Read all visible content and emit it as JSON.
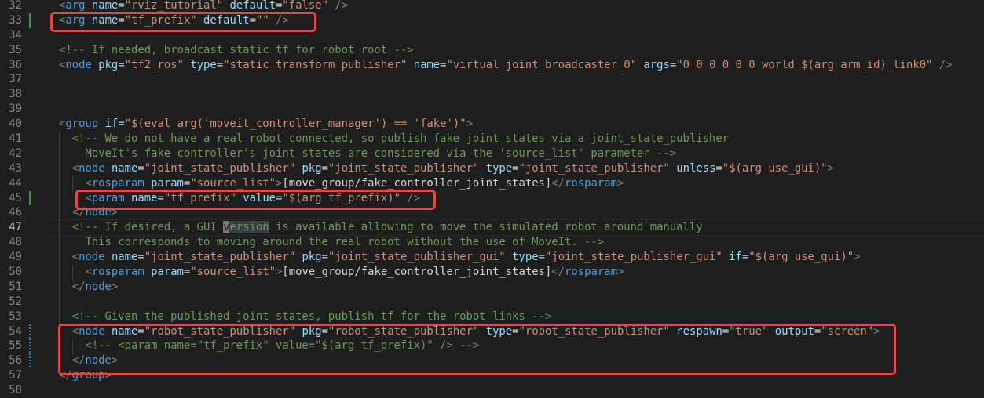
{
  "editor": {
    "colors": {
      "background": "#1e1e1e",
      "tag": "#569cd6",
      "attribute": "#9cdcfe",
      "string": "#ce9178",
      "comment": "#6a9955",
      "bracket": "#808080",
      "highlight_box": "#e0484a"
    },
    "active_line": 47,
    "lines": [
      {
        "n": 32,
        "indent": "",
        "tokens": [
          [
            "b",
            "<"
          ],
          [
            "tag",
            "arg"
          ],
          [
            "txt",
            " "
          ],
          [
            "attr",
            "name"
          ],
          [
            "eq",
            "="
          ],
          [
            "str",
            "\"rviz_tutorial\""
          ],
          [
            "txt",
            " "
          ],
          [
            "attr",
            "default"
          ],
          [
            "eq",
            "="
          ],
          [
            "str",
            "\"false\""
          ],
          [
            "txt",
            " "
          ],
          [
            "b",
            "/>"
          ]
        ]
      },
      {
        "n": 33,
        "git": "added",
        "indent": "",
        "tokens": [
          [
            "b",
            "<"
          ],
          [
            "tag",
            "arg"
          ],
          [
            "txt",
            " "
          ],
          [
            "attr",
            "name"
          ],
          [
            "eq",
            "="
          ],
          [
            "str",
            "\"tf_prefix\""
          ],
          [
            "txt",
            " "
          ],
          [
            "attr",
            "default"
          ],
          [
            "eq",
            "="
          ],
          [
            "str",
            "\"\""
          ],
          [
            "txt",
            " "
          ],
          [
            "b",
            "/>"
          ]
        ]
      },
      {
        "n": 34,
        "tokens": []
      },
      {
        "n": 35,
        "indent": "",
        "tokens": [
          [
            "com",
            "<!-- If needed, broadcast static tf for robot root -->"
          ]
        ]
      },
      {
        "n": 36,
        "indent": "",
        "tokens": [
          [
            "b",
            "<"
          ],
          [
            "tag",
            "node"
          ],
          [
            "txt",
            " "
          ],
          [
            "attr",
            "pkg"
          ],
          [
            "eq",
            "="
          ],
          [
            "str",
            "\"tf2_ros\""
          ],
          [
            "txt",
            " "
          ],
          [
            "attr",
            "type"
          ],
          [
            "eq",
            "="
          ],
          [
            "str",
            "\"static_transform_publisher\""
          ],
          [
            "txt",
            " "
          ],
          [
            "attr",
            "name"
          ],
          [
            "eq",
            "="
          ],
          [
            "str",
            "\"virtual_joint_broadcaster_0\""
          ],
          [
            "txt",
            " "
          ],
          [
            "attr",
            "args"
          ],
          [
            "eq",
            "="
          ],
          [
            "str",
            "\"0 0 0 0 0 0 world $(arg arm_id)_link0\""
          ],
          [
            "txt",
            " "
          ],
          [
            "b",
            "/>"
          ]
        ]
      },
      {
        "n": 37,
        "tokens": []
      },
      {
        "n": 38,
        "tokens": []
      },
      {
        "n": 39,
        "tokens": []
      },
      {
        "n": 40,
        "indent": "",
        "tokens": [
          [
            "b",
            "<"
          ],
          [
            "tag",
            "group"
          ],
          [
            "txt",
            " "
          ],
          [
            "attr",
            "if"
          ],
          [
            "eq",
            "="
          ],
          [
            "str",
            "\"$(eval arg('moveit_controller_manager') == 'fake')\""
          ],
          [
            "b",
            ">"
          ]
        ]
      },
      {
        "n": 41,
        "indent": "  ",
        "tokens": [
          [
            "com",
            "<!-- We do not have a real robot connected, so publish fake joint states via a joint_state_publisher"
          ]
        ]
      },
      {
        "n": 42,
        "indent": "    ",
        "tokens": [
          [
            "com",
            "MoveIt's fake controller's joint states are considered via the 'source_list' parameter -->"
          ]
        ]
      },
      {
        "n": 43,
        "indent": "  ",
        "tokens": [
          [
            "b",
            "<"
          ],
          [
            "tag",
            "node"
          ],
          [
            "txt",
            " "
          ],
          [
            "attr",
            "name"
          ],
          [
            "eq",
            "="
          ],
          [
            "str",
            "\"joint_state_publisher\""
          ],
          [
            "txt",
            " "
          ],
          [
            "attr",
            "pkg"
          ],
          [
            "eq",
            "="
          ],
          [
            "str",
            "\"joint_state_publisher\""
          ],
          [
            "txt",
            " "
          ],
          [
            "attr",
            "type"
          ],
          [
            "eq",
            "="
          ],
          [
            "str",
            "\"joint_state_publisher\""
          ],
          [
            "txt",
            " "
          ],
          [
            "attr",
            "unless"
          ],
          [
            "eq",
            "="
          ],
          [
            "str",
            "\"$(arg use_gui)\""
          ],
          [
            "b",
            ">"
          ]
        ]
      },
      {
        "n": 44,
        "indent": "    ",
        "tokens": [
          [
            "b",
            "<"
          ],
          [
            "tag",
            "rosparam"
          ],
          [
            "txt",
            " "
          ],
          [
            "attr",
            "param"
          ],
          [
            "eq",
            "="
          ],
          [
            "str",
            "\"source_list\""
          ],
          [
            "b",
            ">"
          ],
          [
            "txt",
            "[move_group/fake_controller_joint_states]"
          ],
          [
            "b",
            "</"
          ],
          [
            "tag",
            "rosparam"
          ],
          [
            "b",
            ">"
          ]
        ]
      },
      {
        "n": 45,
        "git": "added",
        "indent": "    ",
        "tokens": [
          [
            "b",
            "<"
          ],
          [
            "tag",
            "param"
          ],
          [
            "txt",
            " "
          ],
          [
            "attr",
            "name"
          ],
          [
            "eq",
            "="
          ],
          [
            "str",
            "\"tf_prefix\""
          ],
          [
            "txt",
            " "
          ],
          [
            "attr",
            "value"
          ],
          [
            "eq",
            "="
          ],
          [
            "str",
            "\"$(arg tf_prefix)\""
          ],
          [
            "txt",
            " "
          ],
          [
            "b",
            "/>"
          ]
        ]
      },
      {
        "n": 46,
        "indent": "  ",
        "tokens": [
          [
            "b",
            "</"
          ],
          [
            "tag",
            "node"
          ],
          [
            "b",
            ">"
          ]
        ]
      },
      {
        "n": 47,
        "indent": "  ",
        "tokens": [
          [
            "com",
            "<!-- If desired, a GUI "
          ],
          [
            "comsel",
            "v"
          ],
          [
            "comhl",
            "ersion"
          ],
          [
            "com",
            " is available allowing to move the simulated robot around manually"
          ]
        ]
      },
      {
        "n": 48,
        "indent": "    ",
        "tokens": [
          [
            "com",
            "This corresponds to moving around the real robot without the use of MoveIt. -->"
          ]
        ]
      },
      {
        "n": 49,
        "indent": "  ",
        "tokens": [
          [
            "b",
            "<"
          ],
          [
            "tag",
            "node"
          ],
          [
            "txt",
            " "
          ],
          [
            "attr",
            "name"
          ],
          [
            "eq",
            "="
          ],
          [
            "str",
            "\"joint_state_publisher\""
          ],
          [
            "txt",
            " "
          ],
          [
            "attr",
            "pkg"
          ],
          [
            "eq",
            "="
          ],
          [
            "str",
            "\"joint_state_publisher_gui\""
          ],
          [
            "txt",
            " "
          ],
          [
            "attr",
            "type"
          ],
          [
            "eq",
            "="
          ],
          [
            "str",
            "\"joint_state_publisher_gui\""
          ],
          [
            "txt",
            " "
          ],
          [
            "attr",
            "if"
          ],
          [
            "eq",
            "="
          ],
          [
            "str",
            "\"$(arg use_gui)\""
          ],
          [
            "b",
            ">"
          ]
        ]
      },
      {
        "n": 50,
        "indent": "    ",
        "tokens": [
          [
            "b",
            "<"
          ],
          [
            "tag",
            "rosparam"
          ],
          [
            "txt",
            " "
          ],
          [
            "attr",
            "param"
          ],
          [
            "eq",
            "="
          ],
          [
            "str",
            "\"source_list\""
          ],
          [
            "b",
            ">"
          ],
          [
            "txt",
            "[move_group/fake_controller_joint_states]"
          ],
          [
            "b",
            "</"
          ],
          [
            "tag",
            "rosparam"
          ],
          [
            "b",
            ">"
          ]
        ]
      },
      {
        "n": 51,
        "indent": "  ",
        "tokens": [
          [
            "b",
            "</"
          ],
          [
            "tag",
            "node"
          ],
          [
            "b",
            ">"
          ]
        ]
      },
      {
        "n": 52,
        "tokens": []
      },
      {
        "n": 53,
        "indent": "  ",
        "tokens": [
          [
            "com",
            "<!-- Given the published joint states, publish tf for the robot links -->"
          ]
        ]
      },
      {
        "n": 54,
        "git": "modified",
        "indent": "  ",
        "tokens": [
          [
            "b",
            "<"
          ],
          [
            "tag",
            "node"
          ],
          [
            "txt",
            " "
          ],
          [
            "attr",
            "name"
          ],
          [
            "eq",
            "="
          ],
          [
            "str",
            "\"robot_state_publisher\""
          ],
          [
            "txt",
            " "
          ],
          [
            "attr",
            "pkg"
          ],
          [
            "eq",
            "="
          ],
          [
            "str",
            "\"robot_state_publisher\""
          ],
          [
            "txt",
            " "
          ],
          [
            "attr",
            "type"
          ],
          [
            "eq",
            "="
          ],
          [
            "str",
            "\"robot_state_publisher\""
          ],
          [
            "txt",
            " "
          ],
          [
            "attr",
            "respawn"
          ],
          [
            "eq",
            "="
          ],
          [
            "str",
            "\"true\""
          ],
          [
            "txt",
            " "
          ],
          [
            "attr",
            "output"
          ],
          [
            "eq",
            "="
          ],
          [
            "str",
            "\"screen\""
          ],
          [
            "b",
            ">"
          ]
        ]
      },
      {
        "n": 55,
        "git": "modified",
        "indent": "    ",
        "tokens": [
          [
            "com",
            "<!-- <param name=\"tf_prefix\" value=\"$(arg tf_prefix)\" /> -->"
          ]
        ]
      },
      {
        "n": 56,
        "git": "modified",
        "indent": "  ",
        "tokens": [
          [
            "b",
            "</"
          ],
          [
            "tag",
            "node"
          ],
          [
            "b",
            ">"
          ]
        ]
      },
      {
        "n": 57,
        "indent": "",
        "tokens": [
          [
            "b",
            "</"
          ],
          [
            "tag",
            "group"
          ],
          [
            "b",
            ">"
          ]
        ]
      },
      {
        "n": 58,
        "tokens": []
      }
    ]
  }
}
